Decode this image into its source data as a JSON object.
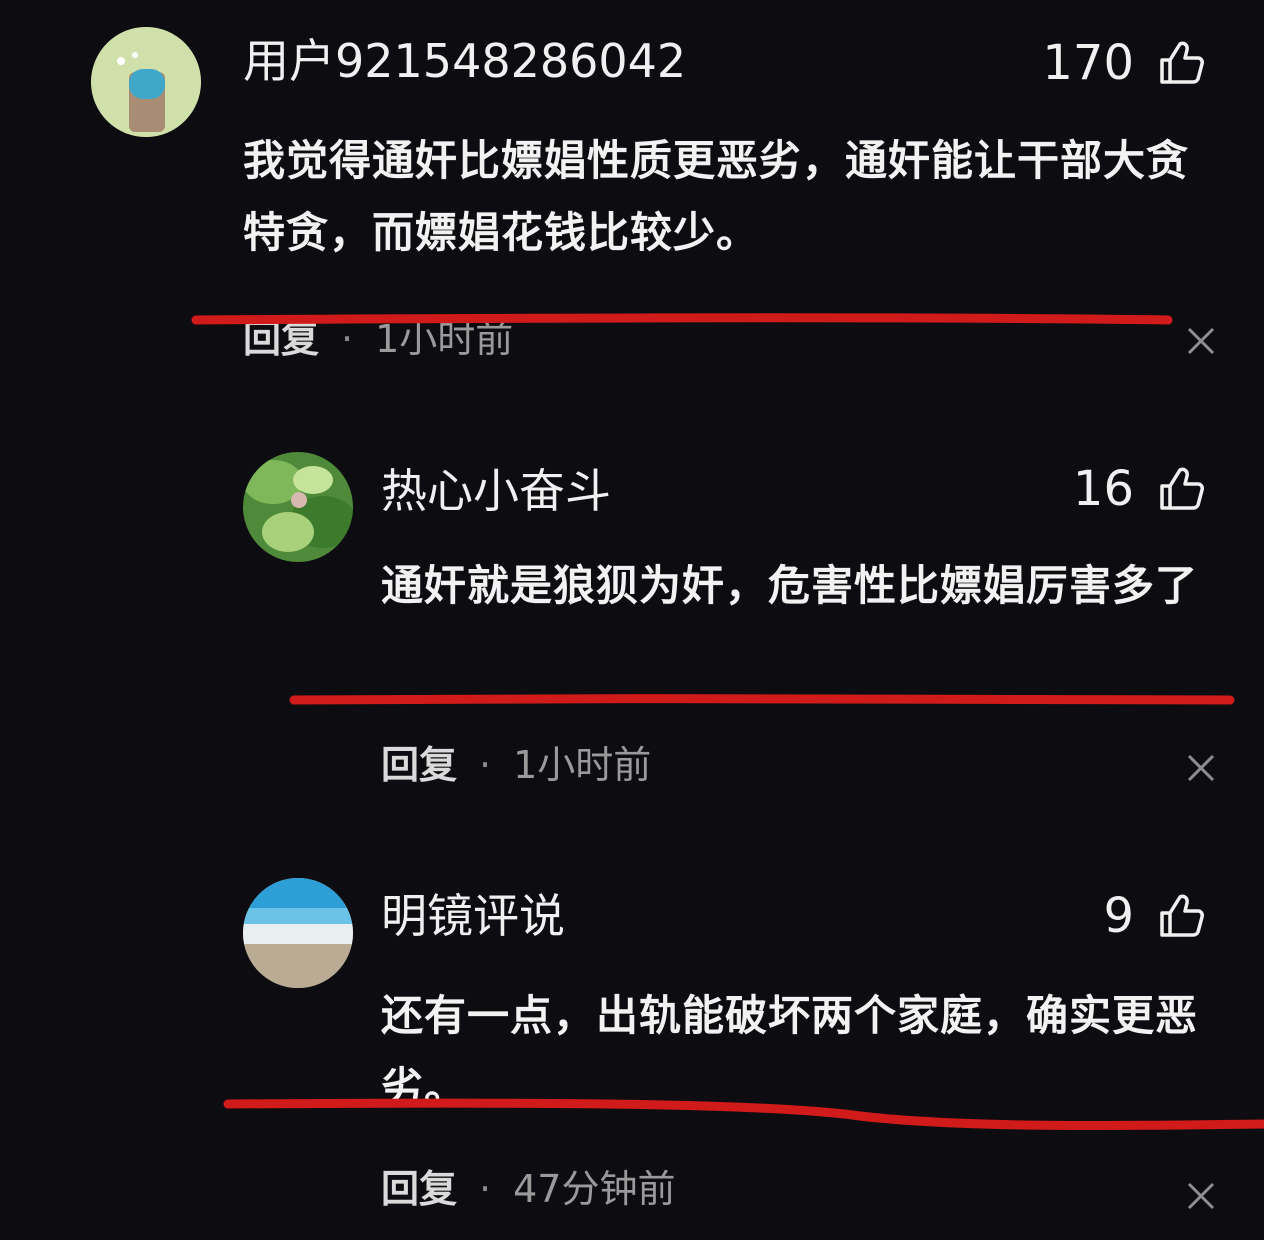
{
  "comments": [
    {
      "username": "用户921548286042",
      "likes": "170",
      "text": "我觉得通奸比嫖娼性质更恶劣，通奸能让干部大贪特贪，而嫖娼花钱比较少。",
      "reply_label": "回复",
      "separator": "·",
      "time": "1小时前"
    },
    {
      "username": "热心小奋斗",
      "likes": "16",
      "text": "通奸就是狼狈为奸，危害性比嫖娼厉害多了",
      "reply_label": "回复",
      "separator": "·",
      "time": "1小时前"
    },
    {
      "username": "明镜评说",
      "likes": "9",
      "text": "还有一点，出轨能破坏两个家庭，确实更恶劣。",
      "reply_label": "回复",
      "separator": "·",
      "time": "47分钟前"
    }
  ],
  "icons": {
    "like": "thumbs-up-icon",
    "close": "close-icon"
  },
  "colors": {
    "background": "#0d0d11",
    "text": "#f2f2f2",
    "muted": "#9a9a9a",
    "annotation_line": "#d11a1a"
  }
}
